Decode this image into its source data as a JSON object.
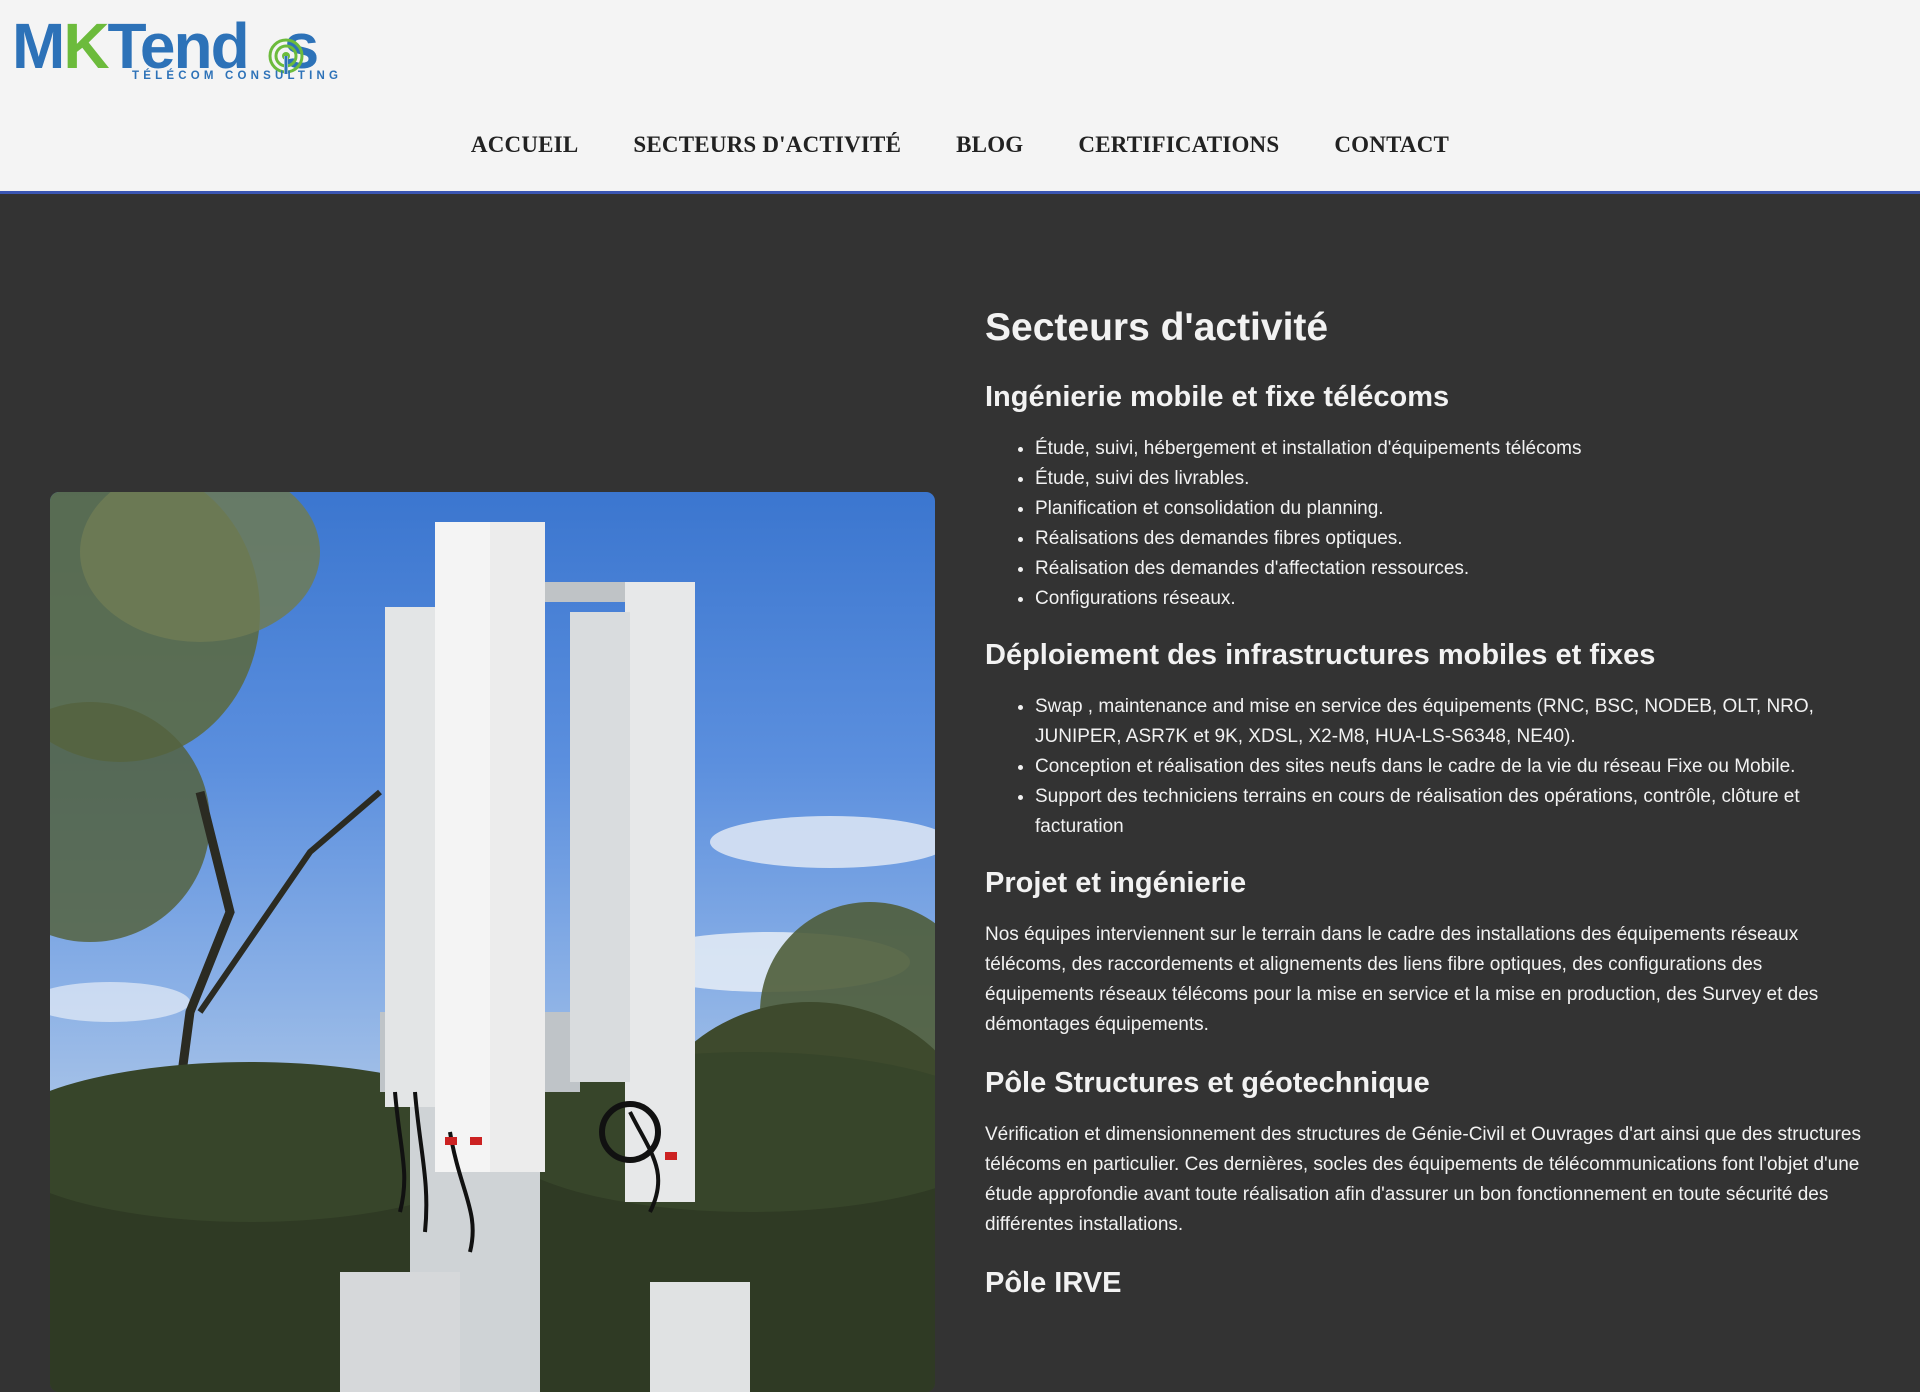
{
  "brand": {
    "logo_m": "M",
    "logo_k": "K",
    "logo_rest": "Tend",
    "logo_end": "s",
    "tagline": "TÉLÉCOM CONSULTING",
    "colors": {
      "blue": "#2d72b8",
      "green": "#6cbb3c"
    }
  },
  "nav": {
    "items": [
      {
        "label": "ACCUEIL"
      },
      {
        "label": "SECTEURS D'ACTIVITÉ"
      },
      {
        "label": "BLOG"
      },
      {
        "label": "CERTIFICATIONS"
      },
      {
        "label": "CONTACT"
      }
    ]
  },
  "hero": {
    "image_alt": "Telecom antenna mast with trees and blue sky"
  },
  "content": {
    "title": "Secteurs d'activité",
    "sections": [
      {
        "heading": "Ingénierie mobile et fixe télécoms",
        "items": [
          "Étude, suivi, hébergement et installation d'équipements télécoms",
          "Étude, suivi des livrables.",
          "Planification et consolidation du planning.",
          "Réalisations des demandes fibres optiques.",
          "Réalisation des demandes d'affectation ressources.",
          "Configurations réseaux."
        ]
      },
      {
        "heading": "Déploiement des infrastructures mobiles et fixes",
        "items": [
          "Swap , maintenance and mise en service des équipements (RNC, BSC, NODEB, OLT, NRO, JUNIPER, ASR7K et 9K, XDSL, X2-M8, HUA-LS-S6348, NE40).",
          "Conception et réalisation des sites neufs dans le cadre de la vie du réseau Fixe ou Mobile.",
          "Support des techniciens terrains en cours de réalisation des opérations, contrôle, clôture et facturation"
        ]
      },
      {
        "heading": "Projet et ingénierie",
        "text": "Nos équipes interviennent sur le terrain dans le cadre des installations des équipements réseaux télécoms, des raccordements et alignements des liens fibre optiques, des configurations des équipements réseaux télécoms pour la mise en service et la mise en production, des Survey et des démontages équipements."
      },
      {
        "heading": "Pôle Structures et géotechnique",
        "text": "Vérification et dimensionnement des structures de Génie-Civil et Ouvrages d'art ainsi que des structures télécoms en particulier. Ces dernières, socles des équipements de télécommunications font l'objet d'une étude approfondie avant toute réalisation afin d'assurer un bon fonctionnement en toute sécurité des différentes installations."
      },
      {
        "heading": "Pôle IRVE"
      }
    ]
  }
}
